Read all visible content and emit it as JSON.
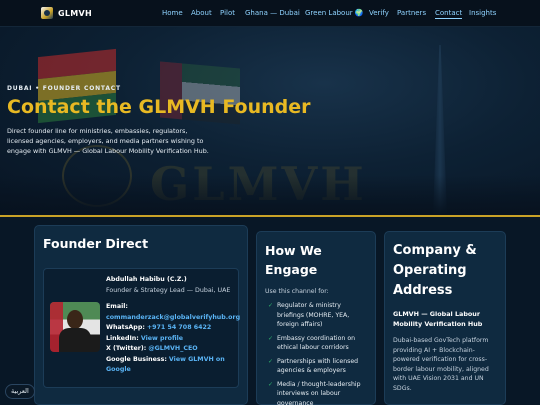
{
  "nav": {
    "brand": "GLMVH",
    "items": [
      "Home",
      "About",
      "Pilot",
      "Ghana — Dubai",
      "Green Labour 🌍",
      "Verify",
      "Partners",
      "Contact",
      "Insights"
    ],
    "active": "Contact"
  },
  "hero": {
    "eyebrow": "DUBAI • FOUNDER CONTACT",
    "title": "Contact the GLMVH Founder",
    "description": "Direct founder line for ministries, embassies, regulators, licensed agencies, employers, and media partners wishing to engage with GLMVH — Global Labour Mobility Verification Hub.",
    "watermark": "GLMVH"
  },
  "founder_card": {
    "title": "Founder Direct",
    "name": "Abdullah Habibu (C.Z.)",
    "role": "Founder & Strategy Lead — Dubai, UAE",
    "email_label": "Email:",
    "email": "commanderzack@globalverifyhub.org",
    "whatsapp_label": "WhatsApp:",
    "whatsapp": "+971 54 708 6422",
    "linkedin_label": "LinkedIn:",
    "linkedin": "View profile",
    "x_label": "X (Twitter):",
    "x_handle": "@GLMVH_CEO",
    "google_label": "Google Business:",
    "google": "View GLMVH on Google"
  },
  "engage_card": {
    "title": "How We Engage",
    "intro": "Use this channel for:",
    "items": [
      "Regulator & ministry briefings (MOHRE, YEA, foreign affairs)",
      "Embassy coordination on ethical labour corridors",
      "Partnerships with licensed agencies & employers",
      "Media / thought-leadership interviews on labour governance"
    ]
  },
  "company_card": {
    "title": "Company & Operating Address",
    "org": "GLMVH — Global Labour Mobility Verification Hub",
    "description": "Dubai-based GovTech platform providing AI + Blockchain-powered verification for cross-border labour mobility, aligned with UAE Vision 2031 and UN SDGs."
  },
  "language_toggle": "العربية",
  "colors": {
    "accent_gold": "#e8b923",
    "link_blue": "#5ab4f5",
    "nav_link": "#8fd3ff",
    "check_green": "#2fb36b",
    "card_bg": "#0f2a40",
    "page_bg": "#081726"
  }
}
